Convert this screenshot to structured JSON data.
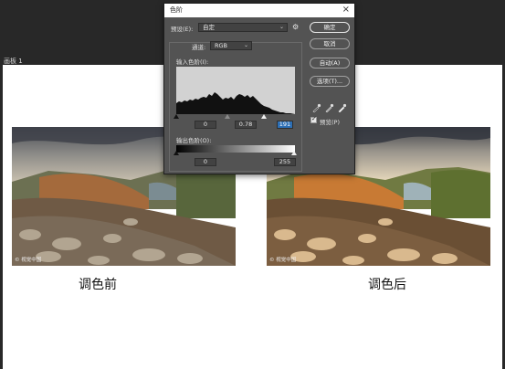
{
  "artboard_label": "画板 1",
  "dialog": {
    "title": "色阶",
    "close_icon": "×",
    "preset_label": "预设(E):",
    "preset_value": "自定",
    "channel_label": "通道:",
    "channel_value": "RGB",
    "input_levels_label": "输入色阶(I):",
    "input_black": "0",
    "input_gamma": "0.78",
    "input_white": "191",
    "output_levels_label": "输出色阶(O):",
    "output_black": "0",
    "output_white": "255",
    "buttons": {
      "ok": "确定",
      "cancel": "取消",
      "auto": "自动(A)",
      "options": "选项(T)..."
    },
    "preview_label": "预览(P)",
    "preview_checked": true
  },
  "photos": {
    "before": {
      "watermark": "© 视觉中国",
      "caption": "调色前"
    },
    "after": {
      "watermark": "© 视觉中国",
      "caption": "调色后"
    }
  },
  "colors": {
    "dialog_bg": "#535353",
    "ps_bg": "#282828",
    "highlight": "#2d6fb5"
  }
}
